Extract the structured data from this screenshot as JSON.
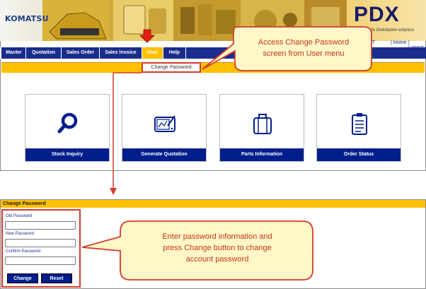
{
  "header": {
    "logo": "KOMATSU",
    "product": "PDX",
    "product_sub": "Parts Distribution eXpress",
    "user_name": "TEST",
    "links": [
      "| Home",
      "| Logout"
    ]
  },
  "nav": {
    "items": [
      "Master",
      "Quotation",
      "Sales Order",
      "Sales Invoice",
      "User",
      "Help"
    ],
    "active": "User",
    "dropdown_item": "Change Password"
  },
  "cards": [
    {
      "label": "Stock Inquiry",
      "icon": "magnifier-icon"
    },
    {
      "label": "Generate Quotation",
      "icon": "drawing-tablet-icon"
    },
    {
      "label": "Parts Information",
      "icon": "briefcase-icon"
    },
    {
      "label": "Order Status",
      "icon": "clipboard-icon"
    }
  ],
  "change_password": {
    "title": "Change Password",
    "old_password_label": "Old Password",
    "new_password_label": "New Password",
    "confirm_password_label": "Confirm Password",
    "change_button": "Change",
    "reset_button": "Reset"
  },
  "callouts": {
    "top_line1": "Access Change Password",
    "top_line2": "screen from User menu",
    "bottom_line1": "Enter password information  and",
    "bottom_line2": "press Change button to change",
    "bottom_line3": "account password"
  },
  "colors": {
    "nav_blue": "#1a2d8c",
    "accent_yellow": "#ffc000",
    "highlight_red": "#d23b2a",
    "callout_fill": "#fff7c8",
    "callout_text": "#c43618"
  }
}
